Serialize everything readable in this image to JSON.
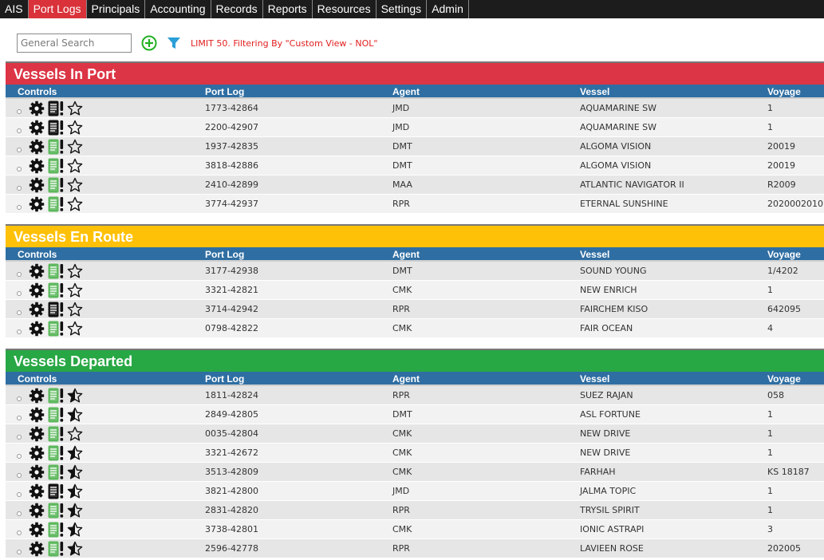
{
  "nav": {
    "tabs": [
      {
        "label": "AIS",
        "active": false
      },
      {
        "label": "Port Logs",
        "active": true
      },
      {
        "label": "Principals",
        "active": false
      },
      {
        "label": "Accounting",
        "active": false
      },
      {
        "label": "Records",
        "active": false
      },
      {
        "label": "Reports",
        "active": false
      },
      {
        "label": "Resources",
        "active": false
      },
      {
        "label": "Settings",
        "active": false
      },
      {
        "label": "Admin",
        "active": false
      }
    ]
  },
  "toolbar": {
    "search_placeholder": "General Search",
    "filter_text": "LIMIT 50. Filtering By \"Custom View - NOL\"",
    "add_icon": "plus-circle-icon",
    "filter_icon": "funnel-icon"
  },
  "columns": [
    "Controls",
    "Port Log",
    "Agent",
    "Vessel",
    "Voyage"
  ],
  "colors": {
    "in_port": "#dc3545",
    "en_route": "#ffc107",
    "departed": "#28a745",
    "header": "#2f6ea2",
    "doc_green": "#5cb85c",
    "doc_black": "#111111"
  },
  "sections": [
    {
      "key": "in_port",
      "title": "Vessels In Port",
      "color": "red",
      "rows": [
        {
          "port_log": "1773-42864",
          "agent": "JMD",
          "vessel": "AQUAMARINE SW",
          "voyage": "1",
          "doc": "black",
          "star": "empty"
        },
        {
          "port_log": "2200-42907",
          "agent": "JMD",
          "vessel": "AQUAMARINE SW",
          "voyage": "1",
          "doc": "black",
          "star": "empty"
        },
        {
          "port_log": "1937-42835",
          "agent": "DMT",
          "vessel": "ALGOMA VISION",
          "voyage": "20019",
          "doc": "green",
          "star": "empty"
        },
        {
          "port_log": "3818-42886",
          "agent": "DMT",
          "vessel": "ALGOMA VISION",
          "voyage": "20019",
          "doc": "green",
          "star": "empty"
        },
        {
          "port_log": "2410-42899",
          "agent": "MAA",
          "vessel": "ATLANTIC NAVIGATOR II",
          "voyage": "R2009",
          "doc": "green",
          "star": "empty"
        },
        {
          "port_log": "3774-42937",
          "agent": "RPR",
          "vessel": "ETERNAL SUNSHINE",
          "voyage": "2020002010",
          "doc": "green",
          "star": "empty"
        }
      ]
    },
    {
      "key": "en_route",
      "title": "Vessels En Route",
      "color": "yellow",
      "rows": [
        {
          "port_log": "3177-42938",
          "agent": "DMT",
          "vessel": "SOUND YOUNG",
          "voyage": "1/4202",
          "doc": "green",
          "star": "empty"
        },
        {
          "port_log": "3321-42821",
          "agent": "CMK",
          "vessel": "NEW ENRICH",
          "voyage": "1",
          "doc": "green",
          "star": "empty"
        },
        {
          "port_log": "3714-42942",
          "agent": "RPR",
          "vessel": "FAIRCHEM KISO",
          "voyage": "642095",
          "doc": "black",
          "star": "empty"
        },
        {
          "port_log": "0798-42822",
          "agent": "CMK",
          "vessel": "FAIR OCEAN",
          "voyage": "4",
          "doc": "green",
          "star": "empty"
        }
      ]
    },
    {
      "key": "departed",
      "title": "Vessels Departed",
      "color": "green",
      "rows": [
        {
          "port_log": "1811-42824",
          "agent": "RPR",
          "vessel": "SUEZ RAJAN",
          "voyage": "058",
          "doc": "green",
          "star": "half"
        },
        {
          "port_log": "2849-42805",
          "agent": "DMT",
          "vessel": "ASL FORTUNE",
          "voyage": "1",
          "doc": "green",
          "star": "half"
        },
        {
          "port_log": "0035-42804",
          "agent": "CMK",
          "vessel": "NEW DRIVE",
          "voyage": "1",
          "doc": "green",
          "star": "empty"
        },
        {
          "port_log": "3321-42672",
          "agent": "CMK",
          "vessel": "NEW DRIVE",
          "voyage": "1",
          "doc": "green",
          "star": "half"
        },
        {
          "port_log": "3513-42809",
          "agent": "CMK",
          "vessel": "FARHAH",
          "voyage": "KS 18187",
          "doc": "green",
          "star": "half"
        },
        {
          "port_log": "3821-42800",
          "agent": "JMD",
          "vessel": "JALMA TOPIC",
          "voyage": "1",
          "doc": "black",
          "star": "half"
        },
        {
          "port_log": "2831-42820",
          "agent": "RPR",
          "vessel": "TRYSIL SPIRIT",
          "voyage": "1",
          "doc": "green",
          "star": "half"
        },
        {
          "port_log": "3738-42801",
          "agent": "CMK",
          "vessel": "IONIC ASTRAPI",
          "voyage": "3",
          "doc": "green",
          "star": "half"
        },
        {
          "port_log": "2596-42778",
          "agent": "RPR",
          "vessel": "LAVIEEN ROSE",
          "voyage": "202005",
          "doc": "green",
          "star": "half"
        }
      ]
    }
  ]
}
